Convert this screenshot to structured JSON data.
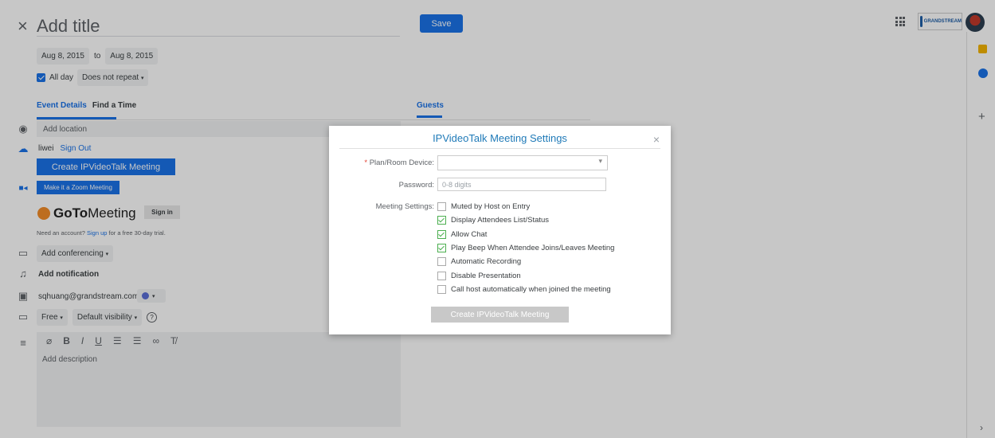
{
  "header": {
    "title": "Add title",
    "save_label": "Save"
  },
  "dates": {
    "start": "Aug 8, 2015",
    "to": "to",
    "end": "Aug 8, 2015"
  },
  "allday": {
    "label": "All day",
    "repeat": "Does not repeat"
  },
  "tabs": {
    "details": "Event Details",
    "find_time": "Find a Time",
    "guests": "Guests"
  },
  "location": {
    "placeholder": "Add location"
  },
  "account": {
    "user": "liwei",
    "sign_out": "Sign Out"
  },
  "ipvt": {
    "create_label": "Create IPVideoTalk Meeting"
  },
  "zoom": {
    "label": "Make it a Zoom Meeting"
  },
  "gotomeeting": {
    "logo_bold": "GoTo",
    "logo_rest": "Meeting",
    "signin": "Sign in",
    "need_account": "Need an account?",
    "signup": "Sign up",
    "trial": "for a free 30-day trial."
  },
  "conferencing": {
    "label": "Add conferencing"
  },
  "notification": {
    "label": "Add notification"
  },
  "calendar": {
    "email": "sqhuang@grandstream.com"
  },
  "visibility": {
    "availability": "Free",
    "visibility": "Default visibility",
    "help": "?"
  },
  "description": {
    "placeholder": "Add description"
  },
  "brand": {
    "name": "GRANDSTREAM"
  },
  "modal": {
    "title": "IPVideoTalk Meeting Settings",
    "close": "×",
    "plan_label": "Plan/Room Device:",
    "required_mark": "*",
    "password_label": "Password:",
    "password_placeholder": "0-8 digits",
    "settings_label": "Meeting Settings:",
    "options": [
      {
        "label": "Muted by Host on Entry",
        "checked": false
      },
      {
        "label": "Display Attendees List/Status",
        "checked": true
      },
      {
        "label": "Allow Chat",
        "checked": true
      },
      {
        "label": "Play Beep When Attendee Joins/Leaves Meeting",
        "checked": true
      },
      {
        "label": "Automatic Recording",
        "checked": false
      },
      {
        "label": "Disable Presentation",
        "checked": false
      },
      {
        "label": "Call host automatically when joined the meeting",
        "checked": false
      }
    ],
    "create_label": "Create IPVideoTalk Meeting"
  },
  "colors": {
    "accent": "#1a73e8",
    "modal_title": "#1f7ab8",
    "check": "#4caf50",
    "disabled_button": "#c8c8c8"
  }
}
